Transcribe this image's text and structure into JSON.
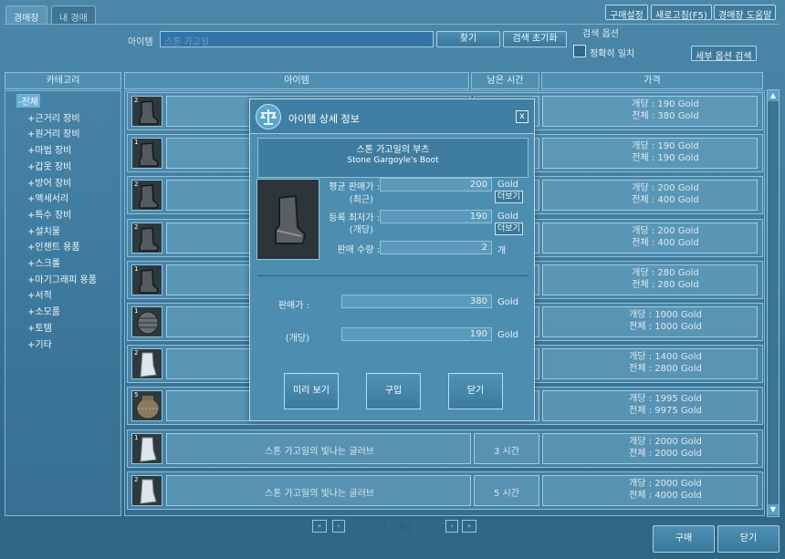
{
  "tabs": [
    "경매장",
    "내 경매"
  ],
  "top_buttons": [
    "구매설정",
    "새로고침(F5)",
    "경매장 도움말"
  ],
  "search": {
    "label": "아이템",
    "placeholder": "스톤 가고일",
    "find_label": "찾기",
    "reset_label": "검색 초기화"
  },
  "search_options": {
    "title": "검색 옵션",
    "exact_label": "정확히 일치",
    "detail_label": "세부 옵션 검색"
  },
  "headers": {
    "category": "카테고리",
    "item": "아이템",
    "time": "남은 시간",
    "price": "가격"
  },
  "categories": [
    "-전체",
    "+근거리 장비",
    "+원거리 장비",
    "+마법 장비",
    "+갑옷 장비",
    "+방어 장비",
    "+액세서리",
    "+특수 장비",
    "+설치물",
    "+인챈트 용품",
    "+스크롤",
    "+마기그래피 용품",
    "+서적",
    "+소모품",
    "+토템",
    "+기타"
  ],
  "rows": [
    {
      "count": "2",
      "icon": "boot-icon",
      "name": "",
      "time": "",
      "unit": "개당 : 190 Gold",
      "total": "전체 : 380 Gold"
    },
    {
      "count": "1",
      "icon": "boot-icon",
      "name": "",
      "time": "",
      "unit": "개당 : 190 Gold",
      "total": "전체 : 190 Gold"
    },
    {
      "count": "2",
      "icon": "boot-icon",
      "name": "",
      "time": "",
      "unit": "개당 : 200 Gold",
      "total": "전체 : 400 Gold"
    },
    {
      "count": "2",
      "icon": "boot-icon",
      "name": "",
      "time": "",
      "unit": "개당 : 200 Gold",
      "total": "전체 : 400 Gold"
    },
    {
      "count": "1",
      "icon": "boot-icon",
      "name": "",
      "time": "",
      "unit": "개당 : 280 Gold",
      "total": "전체 : 280 Gold"
    },
    {
      "count": "1",
      "icon": "armor-icon",
      "name": "",
      "time": "",
      "unit": "개당 : 1000 Gold",
      "total": "전체 : 1000 Gold"
    },
    {
      "count": "2",
      "icon": "glove-icon",
      "name": "",
      "time": "",
      "unit": "개당 : 1400 Gold",
      "total": "전체 : 2800 Gold"
    },
    {
      "count": "5",
      "icon": "jar-icon",
      "name": "",
      "time": "",
      "unit": "개당 : 1995 Gold",
      "total": "전체 : 9975 Gold"
    },
    {
      "count": "1",
      "icon": "glove-icon",
      "name": "스톤 가고일의 빛나는 글러브",
      "time": "3 시간",
      "unit": "개당 : 2000 Gold",
      "total": "전체 : 2000 Gold"
    },
    {
      "count": "2",
      "icon": "glove-icon",
      "name": "스톤 가고일의 빛나는 글러브",
      "time": "5 시간",
      "unit": "개당 : 2000 Gold",
      "total": "전체 : 4000 Gold"
    }
  ],
  "pagination": {
    "page": "1 / 61"
  },
  "bottom": {
    "buy": "구매",
    "close": "닫기"
  },
  "modal": {
    "title": "아이템 상세 정보",
    "item_name_kr": "스톤 가고일의 부츠",
    "item_name_en": "Stone Gargoyle's Boot",
    "avg_label": "평균 판매가 :",
    "avg_sub": "(최근)",
    "avg_value": "200",
    "min_label": "등록 최저가 :",
    "min_sub": "(개당)",
    "min_value": "190",
    "qty_label": "판매 수량 :",
    "qty_value": "2",
    "qty_unit": "개",
    "gold": "Gold",
    "more": "더보기",
    "sale_label": "판매가 :",
    "sale_value": "380",
    "unit_label": "(개당)",
    "unit_value": "190",
    "preview": "미리 보기",
    "buy": "구입",
    "close": "닫기"
  }
}
